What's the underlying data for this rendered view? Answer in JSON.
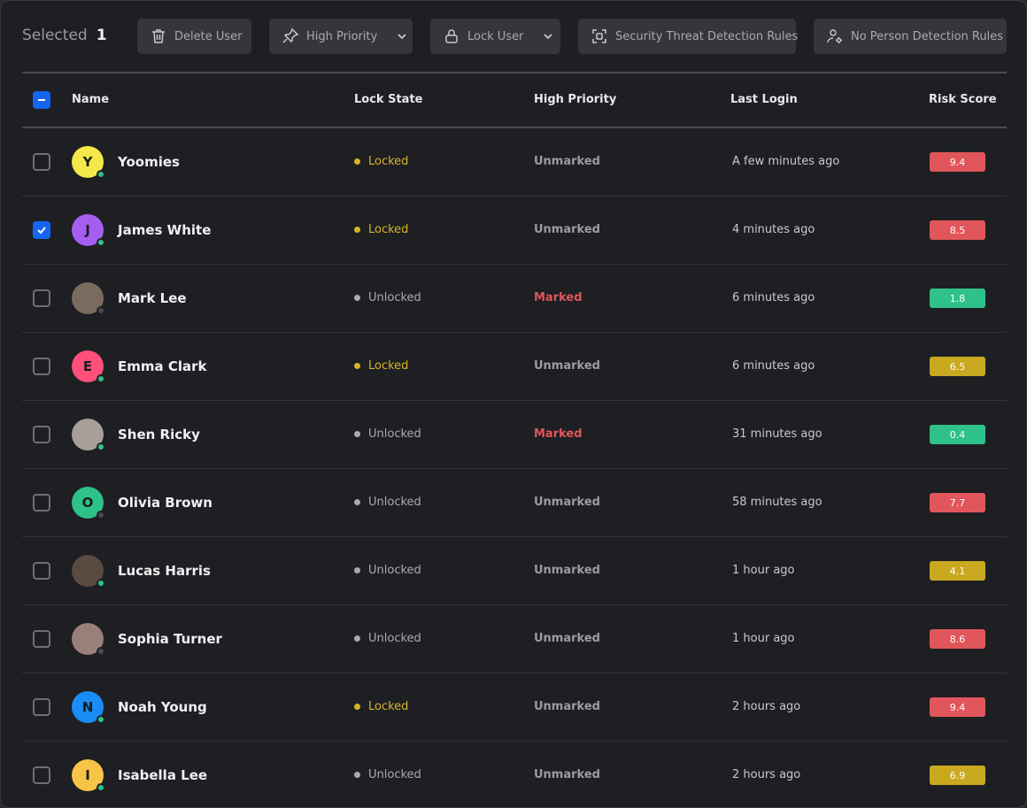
{
  "toolbar": {
    "selected_label": "Selected",
    "selected_count": "1",
    "buttons": {
      "delete": {
        "label": "Delete User",
        "icon": "trash-icon"
      },
      "priority": {
        "label": "High Priority",
        "icon": "pin-icon"
      },
      "lock": {
        "label": "Lock User",
        "icon": "lock-icon"
      },
      "security": {
        "label": "Security Threat Detection Rules",
        "icon": "scan-icon"
      },
      "noperson": {
        "label": "No Person Detection Rules",
        "icon": "user-gear-icon"
      }
    }
  },
  "table": {
    "headers": {
      "name": "Name",
      "lock": "Lock State",
      "priority": "High Priority",
      "login": "Last Login",
      "risk": "Risk Score"
    },
    "rows": [
      {
        "initial": "Y",
        "avatar_color": "#f5e94a",
        "name": "Yoomies",
        "online": true,
        "lock": "Locked",
        "priority": "Unmarked",
        "login": "A few minutes ago",
        "risk": "9.4",
        "risk_color": "#e0565b",
        "checked": false
      },
      {
        "initial": "J",
        "avatar_color": "#a55ff0",
        "name": "James White",
        "online": true,
        "lock": "Locked",
        "priority": "Unmarked",
        "login": "4 minutes ago",
        "risk": "8.5",
        "risk_color": "#e0565b",
        "checked": true
      },
      {
        "initial": "",
        "avatar_color": "#7b6a5e",
        "name": "Mark Lee",
        "online": false,
        "lock": "Unlocked",
        "priority": "Marked",
        "login": "6 minutes ago",
        "risk": "1.8",
        "risk_color": "#2fc18a",
        "checked": false
      },
      {
        "initial": "E",
        "avatar_color": "#ff4f7b",
        "name": "Emma Clark",
        "online": true,
        "lock": "Locked",
        "priority": "Unmarked",
        "login": "6 minutes ago",
        "risk": "6.5",
        "risk_color": "#c9a91f",
        "checked": false
      },
      {
        "initial": "",
        "avatar_color": "#a7a09a",
        "name": "Shen Ricky",
        "online": true,
        "lock": "Unlocked",
        "priority": "Marked",
        "login": "31 minutes ago",
        "risk": "0.4",
        "risk_color": "#2fc18a",
        "checked": false
      },
      {
        "initial": "O",
        "avatar_color": "#2fc18a",
        "name": "Olivia Brown",
        "online": false,
        "lock": "Unlocked",
        "priority": "Unmarked",
        "login": "58 minutes ago",
        "risk": "7.7",
        "risk_color": "#e0565b",
        "checked": false
      },
      {
        "initial": "",
        "avatar_color": "#5a4a40",
        "name": "Lucas Harris",
        "online": true,
        "lock": "Unlocked",
        "priority": "Unmarked",
        "login": "1 hour ago",
        "risk": "4.1",
        "risk_color": "#c9a91f",
        "checked": false
      },
      {
        "initial": "",
        "avatar_color": "#9b7f7a",
        "name": "Sophia Turner",
        "online": false,
        "lock": "Unlocked",
        "priority": "Unmarked",
        "login": "1 hour ago",
        "risk": "8.6",
        "risk_color": "#e0565b",
        "checked": false
      },
      {
        "initial": "N",
        "avatar_color": "#1a8cf5",
        "name": "Noah Young",
        "online": true,
        "lock": "Locked",
        "priority": "Unmarked",
        "login": "2 hours ago",
        "risk": "9.4",
        "risk_color": "#e0565b",
        "checked": false
      },
      {
        "initial": "I",
        "avatar_color": "#f7c545",
        "name": "Isabella Lee",
        "online": true,
        "lock": "Unlocked",
        "priority": "Unmarked",
        "login": "2 hours ago",
        "risk": "6.9",
        "risk_color": "#c9a91f",
        "checked": false
      }
    ]
  },
  "colors": {
    "locked": "#d6b42a",
    "unlocked": "#a9aab0",
    "marked": "#e0565b",
    "unmarked": "#9b9ca2",
    "online": "#2fc18a",
    "offline": "#4a4b51",
    "accent": "#1565f2"
  }
}
